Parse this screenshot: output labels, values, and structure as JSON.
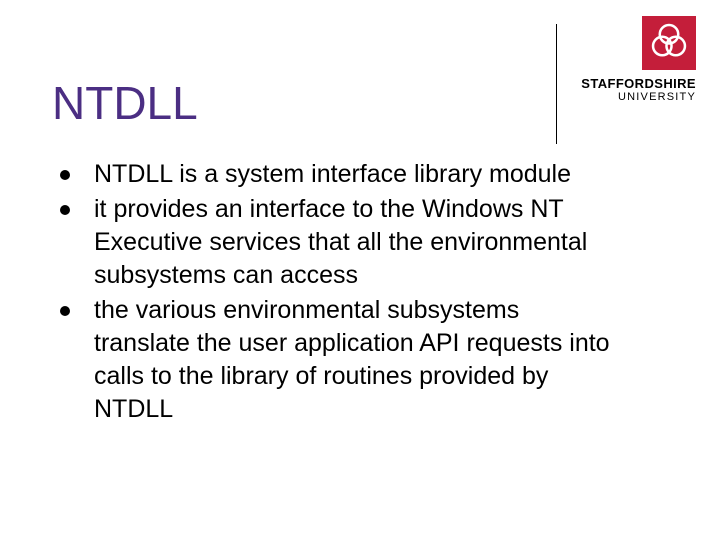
{
  "brand": {
    "line1": "STAFFORDSHIRE",
    "line2": "UNIVERSITY"
  },
  "slide": {
    "title": "NTDLL",
    "bullets": [
      "NTDLL is a system interface library module",
      "it provides an interface to the Windows NT Executive services that all the environmental subsystems can access",
      "the various environmental subsystems translate the user application API requests into calls to the library of routines provided by NTDLL"
    ]
  }
}
